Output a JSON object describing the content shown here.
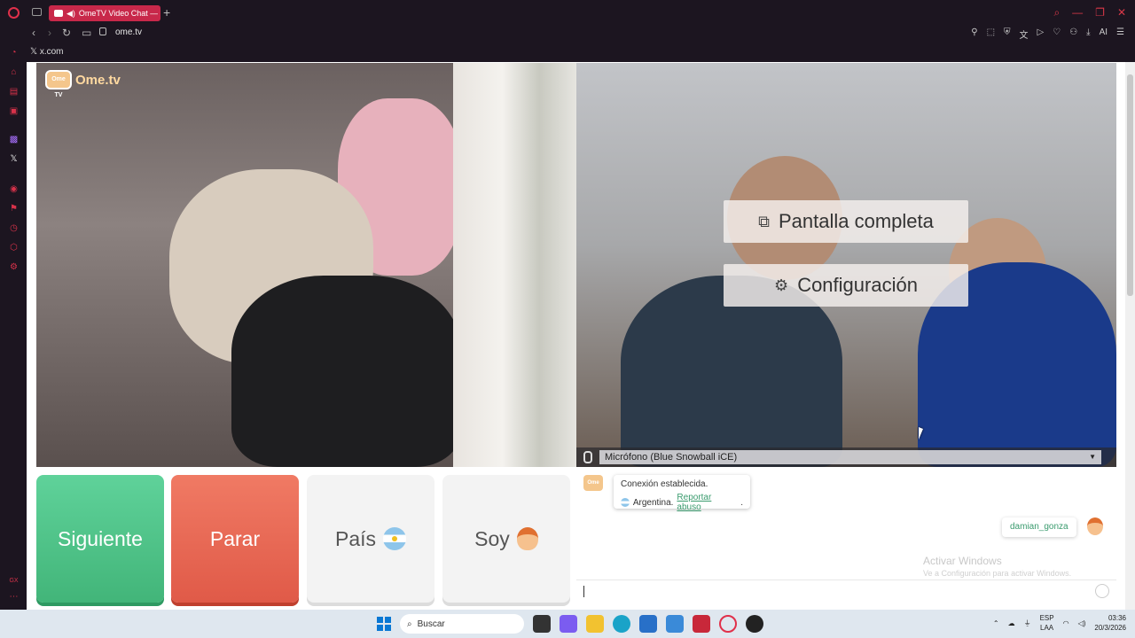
{
  "browser": {
    "tab_title": "OmeTV Video Chat — ",
    "url": "ome.tv",
    "bookmark": "x.com",
    "ai_label": "AI",
    "sidebar_label": "GX",
    "accent": "#d8324a"
  },
  "stranger_video": {
    "logo_badge": "Ome TV",
    "logo_text": "Ome.tv"
  },
  "self_video": {
    "fullscreen_label": "Pantalla completa",
    "settings_label": "Configuración",
    "microphone": "Micrófono (Blue Snowball iCE)"
  },
  "controls": {
    "next_label": "Siguiente",
    "stop_label": "Parar",
    "country_label": "País",
    "country_flag": "argentina-flag-icon",
    "gender_label": "Soy",
    "gender_icon": "boy-emoji-icon",
    "next_color": "#4cc486",
    "stop_color": "#e8654f"
  },
  "chat": {
    "logo_badge": "Ome TV",
    "system_line1": "Conexión establecida.",
    "system_country": "Argentina.",
    "report_link": "Reportar abuso",
    "system_end": ".",
    "username": "damian_gonza",
    "watermark_title": "Activar Windows",
    "watermark_sub": "Ve a Configuración para activar Windows."
  },
  "taskbar": {
    "search_placeholder": "Buscar",
    "lang_1": "ESP",
    "lang_2": "LAA",
    "time": "03:36",
    "date": "20/3/2026"
  }
}
